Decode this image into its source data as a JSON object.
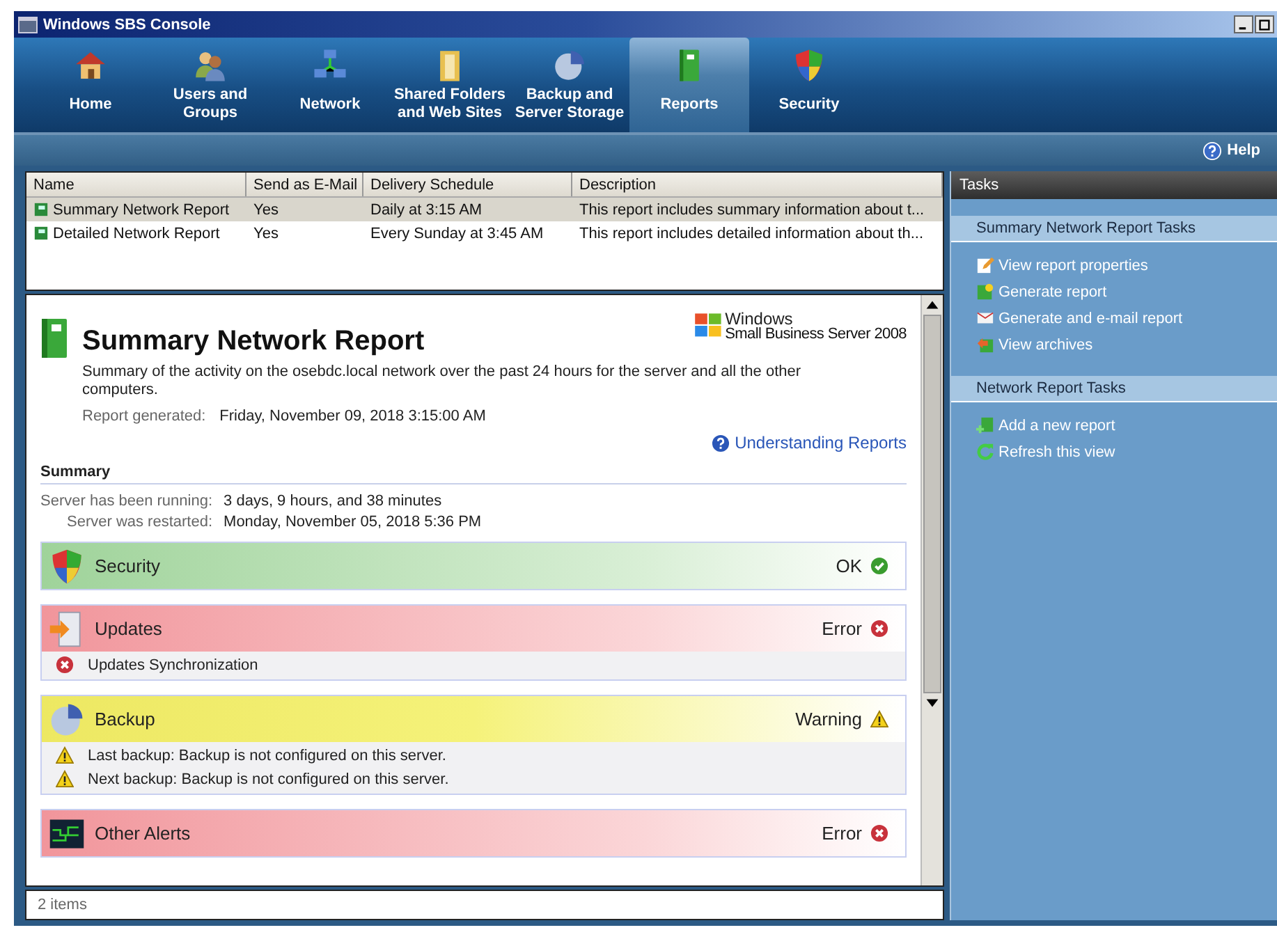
{
  "window": {
    "title": "Windows SBS Console"
  },
  "nav": [
    {
      "label": "Home",
      "kind": "home",
      "selected": false
    },
    {
      "label": "Users and Groups",
      "kind": "users",
      "selected": false
    },
    {
      "label": "Network",
      "kind": "network",
      "selected": false
    },
    {
      "label": "Shared Folders and Web Sites",
      "kind": "folder",
      "selected": false
    },
    {
      "label": "Backup and Server Storage",
      "kind": "backup",
      "selected": false
    },
    {
      "label": "Reports",
      "kind": "reports",
      "selected": true
    },
    {
      "label": "Security",
      "kind": "security",
      "selected": false
    }
  ],
  "help": "Help",
  "reports_list": {
    "columns": [
      "Name",
      "Send as E-Mail",
      "Delivery Schedule",
      "Description"
    ],
    "rows": [
      {
        "selected": true,
        "cells": [
          "Summary Network Report",
          "Yes",
          "Daily at 3:15 AM",
          "This report includes summary information about t..."
        ]
      },
      {
        "selected": false,
        "cells": [
          "Detailed Network Report",
          "Yes",
          "Every Sunday at 3:45 AM",
          "This report includes detailed information about th..."
        ]
      }
    ]
  },
  "report": {
    "title": "Summary Network Report",
    "logo": {
      "brand": "Windows",
      "product": "Small Business Server 2008"
    },
    "description": "Summary of the activity on the osebdc.local network over the past 24 hours for the server and all the other computers.",
    "generated_label": "Report generated:",
    "generated_value": "Friday, November 09, 2018 3:15:00 AM",
    "link": "Understanding Reports",
    "summary_heading": "Summary",
    "facts": [
      {
        "label": "Server has been running:",
        "value": "3 days, 9 hours, and 38 minutes"
      },
      {
        "label": "Server was restarted:",
        "value": "Monday, November 05, 2018 5:36 PM"
      }
    ],
    "sections": [
      {
        "title": "Security",
        "kind": "security",
        "status": {
          "kind": "ok",
          "label": "OK"
        }
      },
      {
        "title": "Updates",
        "kind": "updates",
        "status": {
          "kind": "error",
          "label": "Error"
        },
        "items": [
          {
            "kind": "error",
            "text": "Updates Synchronization"
          }
        ]
      },
      {
        "title": "Backup",
        "kind": "backup",
        "status": {
          "kind": "warning",
          "label": "Warning"
        },
        "items": [
          {
            "kind": "warning",
            "text": "Last backup: Backup is not configured on this server."
          },
          {
            "kind": "warning",
            "text": "Next backup: Backup is not configured on this server."
          }
        ]
      },
      {
        "title": "Other Alerts",
        "kind": "alerts",
        "status": {
          "kind": "error",
          "label": "Error"
        }
      }
    ]
  },
  "status_bar": "2 items",
  "tasks": {
    "title": "Tasks",
    "groups": [
      {
        "title": "Summary Network Report Tasks",
        "items": [
          {
            "label": "View report properties",
            "kind": "properties"
          },
          {
            "label": "Generate report",
            "kind": "generate"
          },
          {
            "label": "Generate and e-mail report",
            "kind": "email"
          },
          {
            "label": "View archives",
            "kind": "archives"
          }
        ]
      },
      {
        "title": "Network Report Tasks",
        "items": [
          {
            "label": "Add a new report",
            "kind": "add"
          },
          {
            "label": "Refresh this view",
            "kind": "refresh"
          }
        ]
      }
    ]
  }
}
